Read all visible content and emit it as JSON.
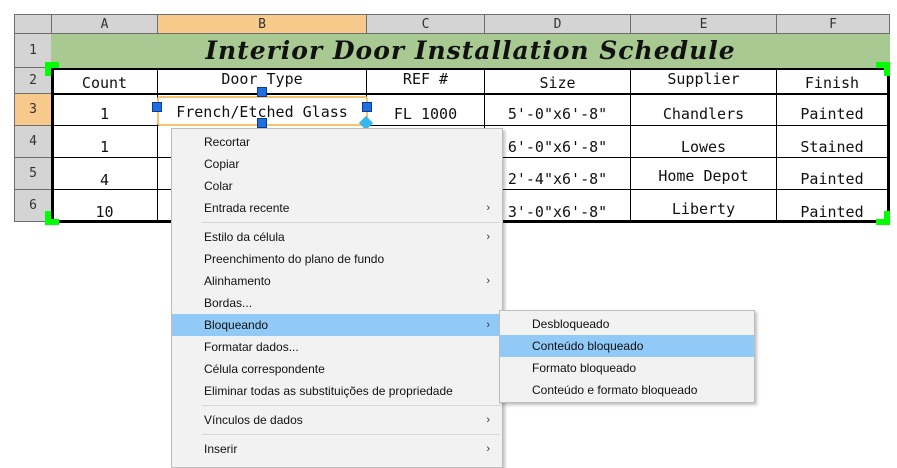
{
  "columns": [
    "A",
    "B",
    "C",
    "D",
    "E",
    "F"
  ],
  "rows": [
    "1",
    "2",
    "3",
    "4",
    "5",
    "6"
  ],
  "title": "Interior Door Installation Schedule",
  "headers": [
    "Count",
    "Door Type",
    "REF #",
    "Size",
    "Supplier",
    "Finish"
  ],
  "data_rows": [
    [
      "1",
      "French/Etched Glass",
      "FL 1000",
      "5'-0\"x6'-8\"",
      "Chandlers",
      "Painted"
    ],
    [
      "1",
      "",
      "",
      "6'-0\"x6'-8\"",
      "Lowes",
      "Stained"
    ],
    [
      "4",
      "",
      "",
      "2'-4\"x6'-8\"",
      "Home Depot",
      "Painted"
    ],
    [
      "10",
      "",
      "",
      "3'-0\"x6'-8\"",
      "Liberty",
      "Painted"
    ]
  ],
  "selection": {
    "column": "B",
    "row": "3"
  },
  "context_menu": {
    "items": [
      {
        "label": "Recortar",
        "submenu": false
      },
      {
        "label": "Copiar",
        "submenu": false
      },
      {
        "label": "Colar",
        "submenu": false
      },
      {
        "label": "Entrada recente",
        "submenu": true
      },
      {
        "label": "Estilo da célula",
        "submenu": true
      },
      {
        "label": "Preenchimento do plano de fundo",
        "submenu": false
      },
      {
        "label": "Alinhamento",
        "submenu": true
      },
      {
        "label": "Bordas...",
        "submenu": false
      },
      {
        "label": "Bloqueando",
        "submenu": true,
        "highlighted": true
      },
      {
        "label": "Formatar dados...",
        "submenu": false
      },
      {
        "label": "Célula correspondente",
        "submenu": false
      },
      {
        "label": "Eliminar todas as substituições de propriedade",
        "submenu": false
      },
      {
        "label": "Vínculos de dados",
        "submenu": true
      },
      {
        "label": "Inserir",
        "submenu": true
      }
    ],
    "submenu_arrow": "›"
  },
  "locking_submenu": {
    "items": [
      {
        "label": "Desbloqueado"
      },
      {
        "label": "Conteúdo bloqueado",
        "highlighted": true
      },
      {
        "label": "Formato bloqueado"
      },
      {
        "label": "Conteúdo e formato bloqueado"
      }
    ]
  },
  "colors": {
    "title_fill": "#a9c992",
    "selected_header": "#f7c98a",
    "grip_color": "#00ff00",
    "handle_color": "#1f6fe0",
    "menu_highlight": "#91c9f7"
  }
}
